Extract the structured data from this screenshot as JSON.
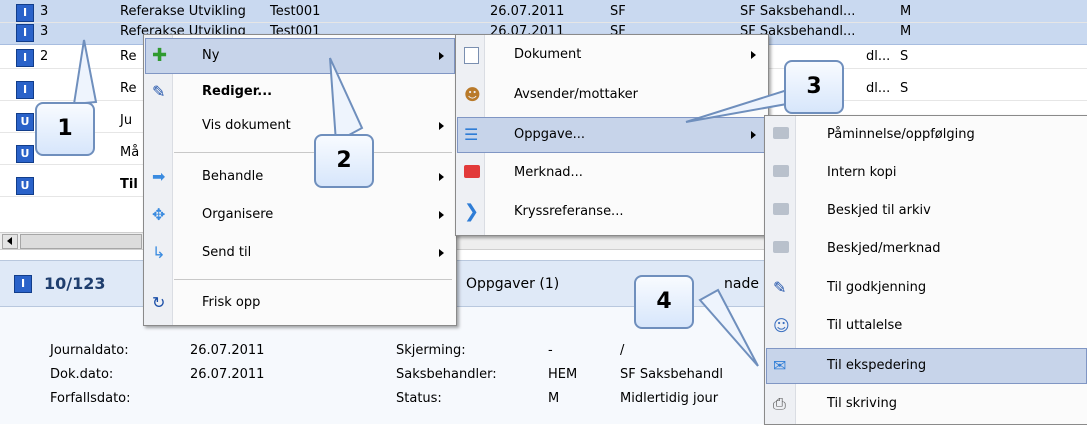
{
  "grid": {
    "rows": [
      {
        "type": "I",
        "num": "3",
        "title": "Referakse Utvikling",
        "sak": "Test001",
        "date": "26.07.2011",
        "unit": "SF",
        "handler": "SF Saksbehandl...",
        "status": "M",
        "selected": true
      },
      {
        "type": "I",
        "num": "2",
        "title": "Re",
        "sak": "",
        "date": "",
        "unit": "",
        "handler": "dl...",
        "status": "S",
        "selected": false
      },
      {
        "type": "I",
        "num": "",
        "title": "Re",
        "sak": "",
        "date": "",
        "unit": "",
        "handler": "dl...",
        "status": "S",
        "selected": false
      },
      {
        "type": "U",
        "num": "",
        "title": "Ju",
        "sak": "",
        "date": "",
        "unit": "",
        "handler": "",
        "status": "",
        "selected": false
      },
      {
        "type": "U",
        "num": "",
        "title": "Må",
        "sak": "",
        "date": "",
        "unit": "",
        "handler": "",
        "status": "",
        "selected": false
      },
      {
        "type": "U",
        "num": "",
        "title": "Til",
        "sak": "",
        "date": "",
        "unit": "",
        "handler": "",
        "status": "",
        "selected": false
      }
    ]
  },
  "detail": {
    "doc_type": "I",
    "doc_id": "10/123",
    "tab_oppgaver": "Oppgaver (1)",
    "tab_partial": "nade",
    "journaldato_label": "Journaldato:",
    "journaldato": "26.07.2011",
    "dokdato_label": "Dok.dato:",
    "dokdato": "26.07.2011",
    "forfallsdato_label": "Forfallsdato:",
    "skjerming_label": "Skjerming:",
    "skjerming": "-",
    "skjerming_extra": "/",
    "saksbehandler_label": "Saksbehandler:",
    "saksbehandler": "HEM",
    "saksbehandler_name": "SF Saksbehandl",
    "status_label": "Status:",
    "status": "M",
    "status_text": "Midlertidig jour"
  },
  "menu1": {
    "items": [
      "Ny",
      "Rediger...",
      "Vis dokument",
      "Behandle",
      "Organisere",
      "Send til",
      "Frisk opp"
    ]
  },
  "menu2": {
    "items": [
      "Dokument",
      "Avsender/mottaker",
      "Oppgave...",
      "Merknad...",
      "Kryssreferanse..."
    ]
  },
  "menu3": {
    "items": [
      "Påminnelse/oppfølging",
      "Intern kopi",
      "Beskjed til arkiv",
      "Beskjed/merknad",
      "Til godkjenning",
      "Til uttalelse",
      "Til ekspedering",
      "Til skriving"
    ]
  },
  "callouts": [
    "1",
    "2",
    "3",
    "4"
  ],
  "colors": {
    "highlight": "#c7d4ea",
    "type_badge": "#2a62c9",
    "detail_header": "#dfe9f7"
  }
}
